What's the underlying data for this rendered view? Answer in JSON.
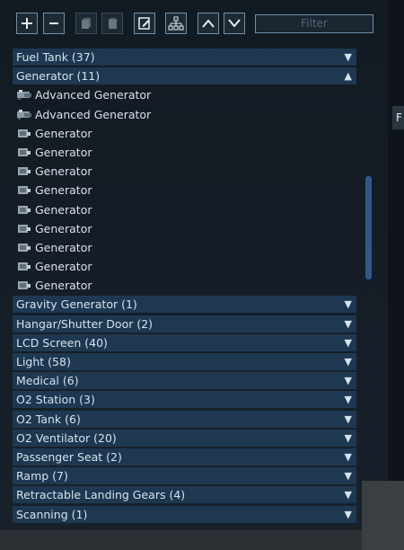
{
  "toolbar": {
    "buttons": [
      {
        "name": "add-button",
        "icon": "plus-icon"
      },
      {
        "name": "remove-button",
        "icon": "minus-icon"
      },
      {
        "name": "copy-button",
        "icon": "copy-icon"
      },
      {
        "name": "paste-button",
        "icon": "paste-icon"
      },
      {
        "name": "edit-button",
        "icon": "edit-icon"
      },
      {
        "name": "hierarchy-button",
        "icon": "hierarchy-icon"
      },
      {
        "name": "move-up-button",
        "icon": "chevron-up-icon"
      },
      {
        "name": "move-down-button",
        "icon": "chevron-down-icon"
      }
    ],
    "filter_placeholder": "Filter"
  },
  "side_tab_label": "F",
  "list": {
    "categories_top": [
      {
        "label": "Fuel Tank (37)",
        "expanded": false
      },
      {
        "label": "Generator (11)",
        "expanded": true
      }
    ],
    "items": [
      {
        "label": "Advanced Generator",
        "icon": "advanced-generator-icon"
      },
      {
        "label": "Advanced Generator",
        "icon": "advanced-generator-icon"
      },
      {
        "label": "Generator",
        "icon": "generator-icon"
      },
      {
        "label": "Generator",
        "icon": "generator-icon"
      },
      {
        "label": "Generator",
        "icon": "generator-icon"
      },
      {
        "label": "Generator",
        "icon": "generator-icon"
      },
      {
        "label": "Generator",
        "icon": "generator-icon"
      },
      {
        "label": "Generator",
        "icon": "generator-icon"
      },
      {
        "label": "Generator",
        "icon": "generator-icon"
      },
      {
        "label": "Generator",
        "icon": "generator-icon"
      },
      {
        "label": "Generator",
        "icon": "generator-icon"
      }
    ],
    "categories_bottom": [
      {
        "label": "Gravity Generator (1)"
      },
      {
        "label": "Hangar/Shutter Door (2)"
      },
      {
        "label": "LCD Screen (40)"
      },
      {
        "label": "Light (58)"
      },
      {
        "label": "Medical (6)"
      },
      {
        "label": "O2 Station (3)"
      },
      {
        "label": "O2 Tank (6)"
      },
      {
        "label": "O2 Ventilator (20)"
      },
      {
        "label": "Passenger Seat (2)"
      },
      {
        "label": "Ramp (7)"
      },
      {
        "label": "Retractable Landing Gears (4)"
      },
      {
        "label": "Scanning (1)"
      }
    ],
    "arrow_down": "▼",
    "arrow_up": "▲"
  },
  "colors": {
    "category_bg": "#1e3852",
    "panel_bg": "#121a22",
    "accent_border": "#6f8fa8",
    "scrollbar": "#2f5a88"
  }
}
